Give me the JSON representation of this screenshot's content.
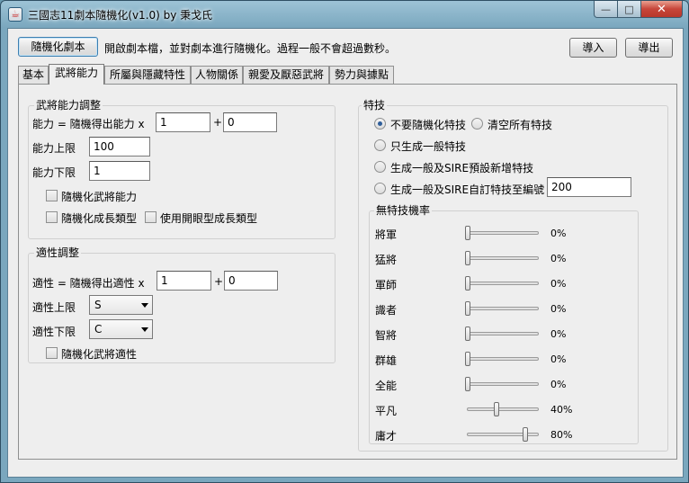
{
  "window": {
    "title": "三國志11劇本隨機化(v1.0) by 秉戈氏",
    "app_icon": "java-cup-icon",
    "minimize": "—",
    "maximize": "□",
    "close": "✕"
  },
  "toolbar": {
    "randomize_button": "隨機化劇本",
    "description": "開啟劇本檔，並對劇本進行隨機化。過程一般不會超過數秒。",
    "import_button": "導入",
    "export_button": "導出"
  },
  "tabs": [
    {
      "label": "基本",
      "active": false
    },
    {
      "label": "武將能力",
      "active": true
    },
    {
      "label": "所屬與隱藏特性",
      "active": false
    },
    {
      "label": "人物關係",
      "active": false
    },
    {
      "label": "親愛及厭惡武將",
      "active": false
    },
    {
      "label": "勢力與據點",
      "active": false
    }
  ],
  "ability": {
    "group_title": "武將能力調整",
    "formula_label": "能力 = 隨機得出能力 x",
    "multiplier": "1",
    "plus": "+",
    "offset": "0",
    "upper_label": "能力上限",
    "upper_value": "100",
    "lower_label": "能力下限",
    "lower_value": "1",
    "randomize_ability": "隨機化武將能力",
    "randomize_growth": "隨機化成長類型",
    "use_open_growth": "使用開眼型成長類型"
  },
  "aptitude": {
    "group_title": "適性調整",
    "formula_label": "適性 = 隨機得出適性 x",
    "multiplier": "1",
    "plus": "+",
    "offset": "0",
    "upper_label": "適性上限",
    "upper_value": "S",
    "lower_label": "適性下限",
    "lower_value": "C",
    "randomize_aptitude": "隨機化武將適性"
  },
  "skills": {
    "group_title": "特技",
    "option_none": "不要隨機化特技",
    "option_clear": "清空所有特技",
    "option_general": "只生成一般特技",
    "option_general_sire": "生成一般及SIRE預設新增特技",
    "option_custom": "生成一般及SIRE自訂特技至編號",
    "custom_number": "200",
    "selected": "none",
    "rate_title": "無特技機率",
    "rates": [
      {
        "label": "將軍",
        "value": 0,
        "text": "0%"
      },
      {
        "label": "猛將",
        "value": 0,
        "text": "0%"
      },
      {
        "label": "軍師",
        "value": 0,
        "text": "0%"
      },
      {
        "label": "識者",
        "value": 0,
        "text": "0%"
      },
      {
        "label": "智將",
        "value": 0,
        "text": "0%"
      },
      {
        "label": "群雄",
        "value": 0,
        "text": "0%"
      },
      {
        "label": "全能",
        "value": 0,
        "text": "0%"
      },
      {
        "label": "平凡",
        "value": 40,
        "text": "40%"
      },
      {
        "label": "庸才",
        "value": 80,
        "text": "80%"
      }
    ]
  }
}
